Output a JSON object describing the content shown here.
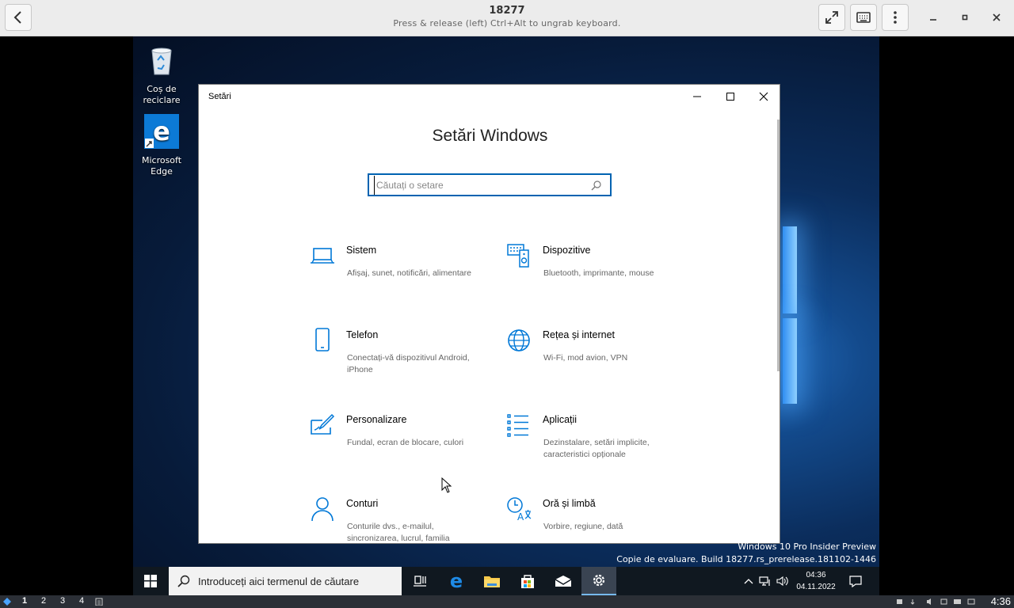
{
  "host": {
    "title": "18277",
    "subtitle": "Press & release (left) Ctrl+Alt to ungrab keyboard."
  },
  "desktop": {
    "icons": [
      {
        "label": "Coș de reciclare",
        "icon": "recycle-bin-icon"
      },
      {
        "label": "Microsoft Edge",
        "icon": "edge-icon"
      }
    ],
    "watermark_line1": "Windows 10 Pro Insider Preview",
    "watermark_line2": "Copie de evaluare. Build 18277.rs_prerelease.181102-1446"
  },
  "settings": {
    "window_title": "Setări",
    "heading": "Setări Windows",
    "search_placeholder": "Căutați o setare",
    "tiles": [
      {
        "title": "Sistem",
        "desc": "Afișaj, sunet, notificări, alimentare",
        "icon": "laptop-icon"
      },
      {
        "title": "Dispozitive",
        "desc": "Bluetooth, imprimante, mouse",
        "icon": "devices-icon"
      },
      {
        "title": "Telefon",
        "desc": "Conectați-vă dispozitivul Android, iPhone",
        "icon": "phone-icon"
      },
      {
        "title": "Rețea și internet",
        "desc": "Wi-Fi, mod avion, VPN",
        "icon": "globe-icon"
      },
      {
        "title": "Personalizare",
        "desc": "Fundal, ecran de blocare, culori",
        "icon": "personalization-icon"
      },
      {
        "title": "Aplicații",
        "desc": "Dezinstalare, setări implicite, caracteristici opționale",
        "icon": "apps-list-icon"
      },
      {
        "title": "Conturi",
        "desc": "Conturile dvs., e-mailul, sincronizarea, lucrul, familia",
        "icon": "person-icon"
      },
      {
        "title": "Oră și limbă",
        "desc": "Vorbire, regiune, dată",
        "icon": "time-language-icon"
      }
    ]
  },
  "taskbar": {
    "search_text": "Introduceți aici termenul de căutare",
    "time": "04:36",
    "date": "04.11.2022"
  },
  "host_bottom": {
    "workspaces": [
      "1",
      "2",
      "3",
      "4"
    ],
    "clock": "4:36"
  },
  "colors": {
    "accent": "#0063b1",
    "icon_blue": "#0078d7"
  }
}
